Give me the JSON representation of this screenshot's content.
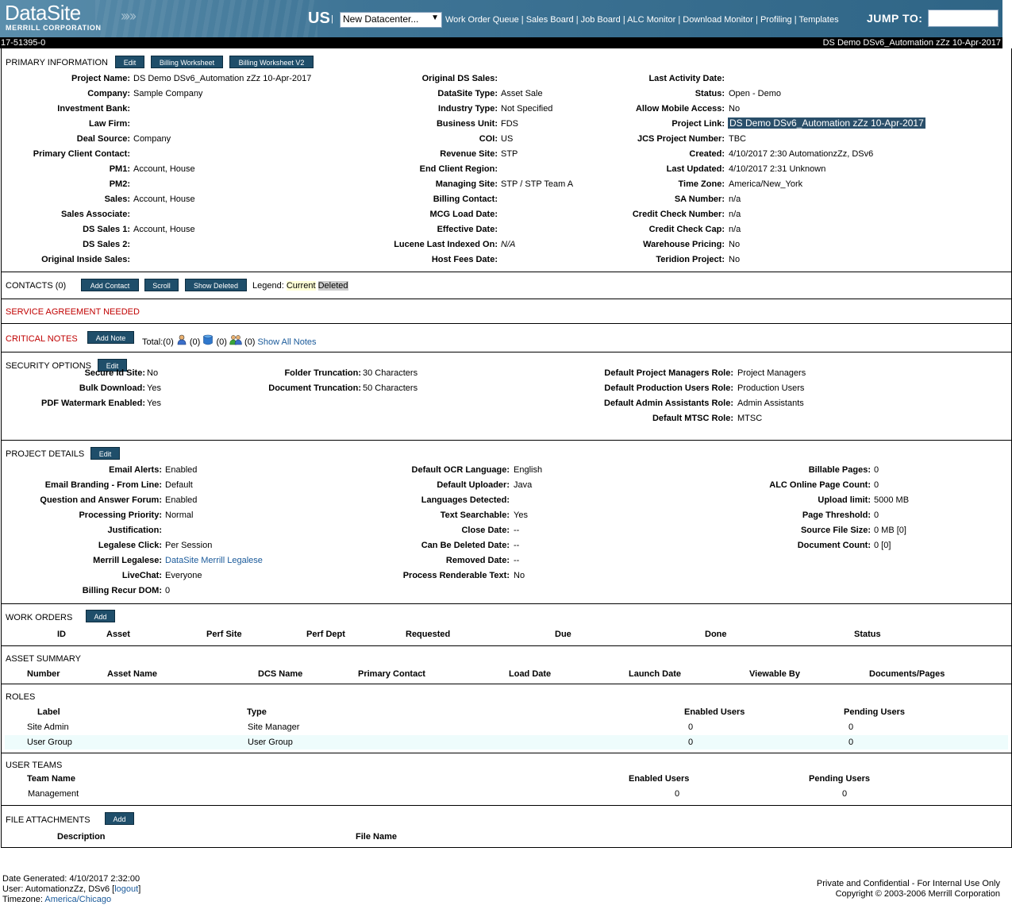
{
  "header": {
    "logo": "DataSite",
    "logo_sub": "MERRILL CORPORATION",
    "region": "US",
    "datacenter": "New Datacenter...",
    "nav": [
      "Work Order Queue",
      "Sales Board",
      "Job Board",
      "ALC Monitor",
      "Download Monitor",
      "Profiling",
      "Templates"
    ],
    "jump_label": "JUMP TO:",
    "project_id": "17-51395-0",
    "project_title": "DS Demo DSv6_Automation zZz 10-Apr-2017"
  },
  "primary": {
    "title": "PRIMARY INFORMATION",
    "buttons": [
      "Edit",
      "Billing Worksheet",
      "Billing Worksheet V2"
    ],
    "col1": [
      {
        "label": "Project Name:",
        "value": "DS Demo DSv6_Automation zZz 10-Apr-2017"
      },
      {
        "label": "Company:",
        "value": "Sample Company"
      },
      {
        "label": "Investment Bank:",
        "value": ""
      },
      {
        "label": "Law Firm:",
        "value": ""
      },
      {
        "label": "Deal Source:",
        "value": "Company"
      },
      {
        "label": "Primary Client Contact:",
        "value": ""
      },
      {
        "label": "PM1:",
        "value": "Account, House"
      },
      {
        "label": "PM2:",
        "value": ""
      },
      {
        "label": "Sales:",
        "value": "Account, House"
      },
      {
        "label": "Sales Associate:",
        "value": ""
      },
      {
        "label": "DS Sales 1:",
        "value": "Account, House"
      },
      {
        "label": "DS Sales 2:",
        "value": ""
      },
      {
        "label": "Original Inside Sales:",
        "value": ""
      }
    ],
    "col2": [
      {
        "label": "Original DS Sales:",
        "value": ""
      },
      {
        "label": "DataSite Type:",
        "value": "Asset Sale"
      },
      {
        "label": "Industry Type:",
        "value": "Not Specified"
      },
      {
        "label": "Business Unit:",
        "value": "FDS"
      },
      {
        "label": "COI:",
        "value": "US"
      },
      {
        "label": "Revenue Site:",
        "value": "STP"
      },
      {
        "label": "End Client Region:",
        "value": ""
      },
      {
        "label": "Managing Site:",
        "value": "STP / STP Team A"
      },
      {
        "label": "Billing Contact:",
        "value": ""
      },
      {
        "label": "MCG Load Date:",
        "value": ""
      },
      {
        "label": "Effective Date:",
        "value": ""
      },
      {
        "label": "Lucene Last Indexed On:",
        "value": "N/A"
      },
      {
        "label": "Host Fees Date:",
        "value": ""
      }
    ],
    "col3": [
      {
        "label": "Last Activity Date:",
        "value": ""
      },
      {
        "label": "Status:",
        "value": "Open  - Demo"
      },
      {
        "label": "Allow Mobile Access:",
        "value": "No"
      },
      {
        "label": "Project Link:",
        "value": "DS Demo DSv6_Automation zZz 10-Apr-2017"
      },
      {
        "label": "JCS Project Number:",
        "value": "TBC"
      },
      {
        "label": "Created:",
        "value": "4/10/2017 2:30   AutomationzZz, DSv6"
      },
      {
        "label": "Last Updated:",
        "value": "4/10/2017 2:31   Unknown"
      },
      {
        "label": "Time Zone:",
        "value": "America/New_York"
      },
      {
        "label": "SA Number:",
        "value": "n/a"
      },
      {
        "label": "Credit Check Number:",
        "value": "n/a"
      },
      {
        "label": "Credit Check Cap:",
        "value": "n/a"
      },
      {
        "label": "Warehouse Pricing:",
        "value": "No"
      },
      {
        "label": "Teridion Project:",
        "value": "No"
      }
    ]
  },
  "contacts": {
    "title": "CONTACTS (0)",
    "buttons": [
      "Add Contact",
      "Scroll",
      "Show Deleted"
    ],
    "legend_label": "Legend:",
    "legend_current": "Current",
    "legend_deleted": "Deleted"
  },
  "service": {
    "title": "SERVICE AGREEMENT NEEDED"
  },
  "notes": {
    "title": "CRITICAL NOTES",
    "button": "Add Note",
    "total": "Total:(0)",
    "c1": "(0)",
    "c2": "(0)",
    "c3": "(0)",
    "show_all": "Show All Notes"
  },
  "security": {
    "title": "SECURITY OPTIONS",
    "button": "Edit",
    "col1": [
      {
        "label": "Secure Id Site:",
        "value": "No"
      },
      {
        "label": "Bulk Download:",
        "value": "Yes"
      },
      {
        "label": "PDF Watermark Enabled:",
        "value": "Yes"
      }
    ],
    "col2": [
      {
        "label": "Folder Truncation:",
        "value": "30 Characters"
      },
      {
        "label": "Document Truncation:",
        "value": "50 Characters"
      }
    ],
    "col3": [
      {
        "label": "Default Project Managers Role:",
        "value": "Project Managers"
      },
      {
        "label": "Default Production Users Role:",
        "value": "Production Users"
      },
      {
        "label": "Default Admin Assistants Role:",
        "value": "Admin Assistants"
      },
      {
        "label": "Default MTSC Role:",
        "value": "MTSC"
      }
    ]
  },
  "details": {
    "title": "PROJECT DETAILS",
    "button": "Edit",
    "col1": [
      {
        "label": "Email Alerts:",
        "value": "Enabled"
      },
      {
        "label": "Email Branding - From Line:",
        "value": "Default"
      },
      {
        "label": "Question and Answer Forum:",
        "value": "Enabled"
      },
      {
        "label": "Processing Priority:",
        "value": "Normal"
      },
      {
        "label": "Justification:",
        "value": ""
      },
      {
        "label": "Legalese Click:",
        "value": "Per Session"
      },
      {
        "label": "Merrill Legalese:",
        "value": "DataSite Merrill Legalese"
      },
      {
        "label": "LiveChat:",
        "value": "Everyone"
      },
      {
        "label": "Billing Recur DOM:",
        "value": "0"
      }
    ],
    "col2": [
      {
        "label": "Default OCR Language:",
        "value": "English"
      },
      {
        "label": "Default Uploader:",
        "value": "Java"
      },
      {
        "label": "Languages Detected:",
        "value": ""
      },
      {
        "label": "Text Searchable:",
        "value": "Yes"
      },
      {
        "label": "Close Date:",
        "value": "--"
      },
      {
        "label": "Can Be Deleted Date:",
        "value": "--"
      },
      {
        "label": "Removed Date:",
        "value": "--"
      },
      {
        "label": "Process Renderable Text:",
        "value": "No"
      }
    ],
    "col3": [
      {
        "label": "Billable Pages:",
        "value": "0"
      },
      {
        "label": "ALC Online Page Count:",
        "value": "0"
      },
      {
        "label": "Upload limit:",
        "value": "5000  MB"
      },
      {
        "label": "Page Threshold:",
        "value": "0"
      },
      {
        "label": "Source File Size:",
        "value": "0 MB  [0]"
      },
      {
        "label": "Document Count:",
        "value": "0 [0]"
      }
    ]
  },
  "work_orders": {
    "title": "WORK ORDERS",
    "button": "Add",
    "columns": [
      "ID",
      "Asset",
      "Perf Site",
      "Perf Dept",
      "Requested",
      "Due",
      "Done",
      "Status"
    ]
  },
  "asset_summary": {
    "title": "ASSET SUMMARY",
    "columns": [
      "Number",
      "Asset Name",
      "DCS Name",
      "Primary Contact",
      "Load Date",
      "Launch Date",
      "Viewable By",
      "Documents/Pages"
    ]
  },
  "roles": {
    "title": "ROLES",
    "columns": [
      "Label",
      "Type",
      "Enabled Users",
      "Pending Users"
    ],
    "rows": [
      [
        "Site Admin",
        "Site Manager",
        "0",
        "0"
      ],
      [
        "User Group",
        "User Group",
        "0",
        "0"
      ]
    ]
  },
  "user_teams": {
    "title": "USER TEAMS",
    "columns": [
      "Team Name",
      "Enabled Users",
      "Pending Users"
    ],
    "rows": [
      [
        "Management",
        "0",
        "0"
      ]
    ]
  },
  "attachments": {
    "title": "FILE ATTACHMENTS",
    "button": "Add",
    "columns": [
      "Description",
      "File Name"
    ]
  },
  "footer": {
    "date_generated": "Date Generated: 4/10/2017 2:32:00",
    "user_prefix": "User: AutomationzZz, DSv6 [",
    "logout": "logout",
    "user_suffix": "]",
    "tz_prefix": "Timezone: ",
    "timezone": "America/Chicago",
    "private": "Private and Confidential - For Internal Use Only",
    "copyright": "Copyright © 2003-2006 Merrill Corporation"
  }
}
